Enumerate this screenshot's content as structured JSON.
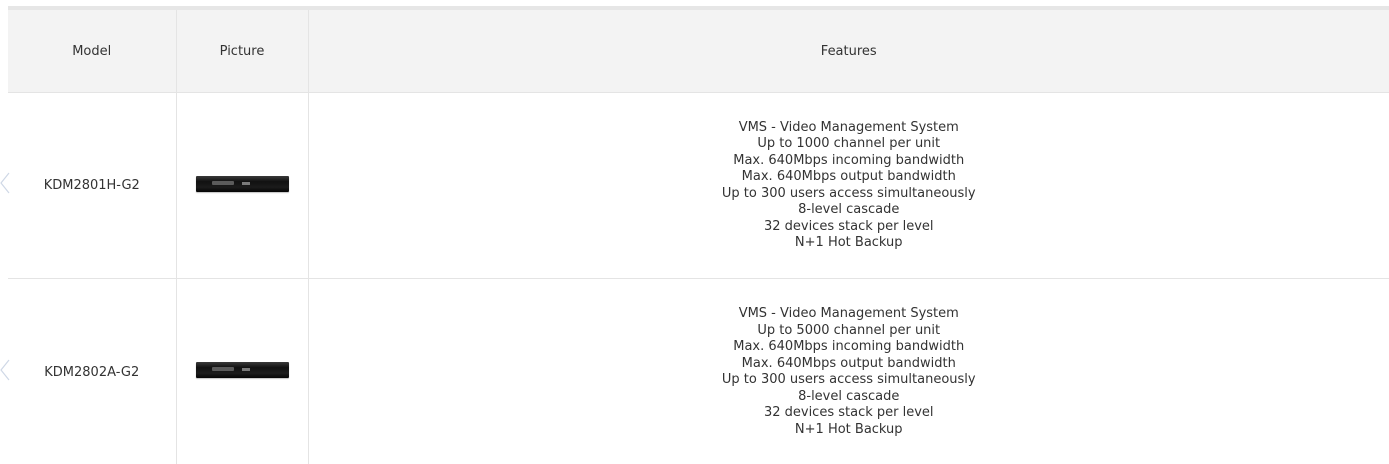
{
  "table": {
    "headers": {
      "model": "Model",
      "picture": "Picture",
      "features": "Features"
    },
    "rows": [
      {
        "model": "KDM2801H-G2",
        "picture_icon": "nvr-device-image",
        "features": [
          "VMS - Video Management System",
          "Up to 1000 channel per unit",
          "Max. 640Mbps incoming bandwidth",
          "Max. 640Mbps output bandwidth",
          "Up to 300 users access simultaneously",
          "8-level cascade",
          "32 devices stack per level",
          "N+1 Hot Backup"
        ]
      },
      {
        "model": "KDM2802A-G2",
        "picture_icon": "nvr-device-image",
        "features": [
          "VMS - Video Management System",
          "Up to 5000 channel per unit",
          "Max. 640Mbps incoming bandwidth",
          "Max. 640Mbps output bandwidth",
          "Up to 300 users access simultaneously",
          "8-level cascade",
          "32 devices stack per level",
          "N+1 Hot Backup"
        ]
      }
    ]
  },
  "colors": {
    "header_bg": "#f3f3f3",
    "border": "#e4e4e4",
    "text": "#333333",
    "arrow": "#cfd8e6"
  },
  "icons": {
    "side_arrow": "chevron-left-icon"
  }
}
